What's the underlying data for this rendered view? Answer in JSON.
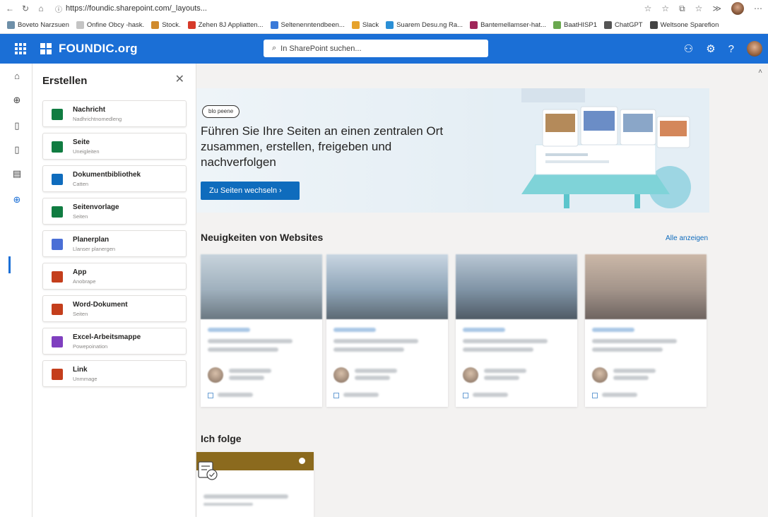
{
  "browser": {
    "url": "https://foundic.sharepoint.com/_layouts...",
    "bookmarks": [
      {
        "label": "Boveto Narzsuen",
        "color": "#6e8fa8"
      },
      {
        "label": "Onfine Obcy -hask.",
        "color": "#c4c4c4"
      },
      {
        "label": "Stock.",
        "color": "#d08a2c"
      },
      {
        "label": "Zehen 8J Appliatten...",
        "color": "#d63a2a"
      },
      {
        "label": "Seltenenntendbeen...",
        "color": "#3a7ad9"
      },
      {
        "label": "Slack",
        "color": "#e6a22c"
      },
      {
        "label": "Suarem Desu.ng Ra...",
        "color": "#2a8fd6"
      },
      {
        "label": "Bantemellamser-hat...",
        "color": "#a0265a"
      },
      {
        "label": "BaatHISP1",
        "color": "#6aa84f"
      },
      {
        "label": "ChatGPT",
        "color": "#555555"
      },
      {
        "label": "Weltsone Sparefion",
        "color": "#444444"
      }
    ]
  },
  "suite": {
    "brand": "FOUNDIC.org",
    "search_placeholder": "In SharePoint suchen...",
    "accent": "#1b6fd6"
  },
  "panel": {
    "title": "Erstellen",
    "items": [
      {
        "title": "Nachricht",
        "subtitle": "Nadhrichtnomedleng",
        "icon": "news-icon",
        "color": "#107c41"
      },
      {
        "title": "Seite",
        "subtitle": "Uneigleiten",
        "icon": "page-icon",
        "color": "#107c41"
      },
      {
        "title": "Dokumentbibliothek",
        "subtitle": "Catten",
        "icon": "library-icon",
        "color": "#0f6cbd"
      },
      {
        "title": "Seitenvorlage",
        "subtitle": "Seiten",
        "icon": "template-icon",
        "color": "#107c41"
      },
      {
        "title": "Planerplan",
        "subtitle": "Llanser planergen",
        "icon": "planner-icon",
        "color": "#4a6fd6"
      },
      {
        "title": "App",
        "subtitle": "Anobrape",
        "icon": "app-icon",
        "color": "#c43e1c"
      },
      {
        "title": "Word-Dokument",
        "subtitle": "Seiten",
        "icon": "word-icon",
        "color": "#c43e1c"
      },
      {
        "title": "Excel-Arbeitsmappe",
        "subtitle": "Powepoination",
        "icon": "excel-icon",
        "color": "#7f3fbf"
      },
      {
        "title": "Link",
        "subtitle": "Unmmage",
        "icon": "link-icon",
        "color": "#c43e1c"
      }
    ]
  },
  "hero": {
    "tag": "blo peene",
    "headline": "Führen Sie Ihre Seiten an einen zentralen Ort zusammen, erstellen, freigeben und nachverfolgen",
    "button": "Zu Seiten wechseln  ›"
  },
  "news": {
    "title": "Neuigkeiten von Websites",
    "see_all": "Alle anzeigen"
  },
  "following": {
    "title": "Ich folge"
  }
}
